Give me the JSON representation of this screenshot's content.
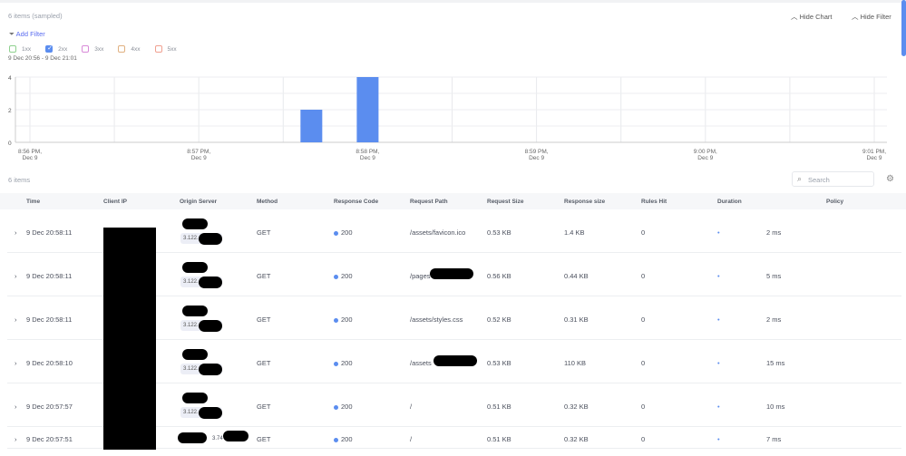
{
  "header": {
    "items_count": "6 items (sampled)",
    "hide_chart": "Hide Chart",
    "hide_filter": "Hide Filter",
    "add_filter": "Add Filter",
    "time_range": "9 Dec 20:56 - 9 Dec 21:01"
  },
  "legend": [
    {
      "label": "1xx",
      "color": "#8fd18f",
      "checked": false
    },
    {
      "label": "2xx",
      "color": "#5b8def",
      "checked": true
    },
    {
      "label": "3xx",
      "color": "#d88ad8",
      "checked": false
    },
    {
      "label": "4xx",
      "color": "#e0b080",
      "checked": false
    },
    {
      "label": "5xx",
      "color": "#f0a090",
      "checked": false
    }
  ],
  "chart_data": {
    "type": "bar",
    "title": "",
    "xlabel": "",
    "ylabel": "",
    "ylim": [
      0,
      4
    ],
    "yticks": [
      "0",
      "2",
      "4"
    ],
    "xlim_seconds": [
      0,
      300
    ],
    "xticks": [
      {
        "s": 0,
        "l1": "8:56 PM,",
        "l2": "Dec 9"
      },
      {
        "s": 60,
        "l1": "8:57 PM,",
        "l2": "Dec 9"
      },
      {
        "s": 120,
        "l1": "8:58 PM,",
        "l2": "Dec 9"
      },
      {
        "s": 180,
        "l1": "8:59 PM,",
        "l2": "Dec 9"
      },
      {
        "s": 240,
        "l1": "9:00 PM,",
        "l2": "Dec 9"
      },
      {
        "s": 300,
        "l1": "9:01 PM,",
        "l2": "Dec 9"
      }
    ],
    "series": [
      {
        "name": "2xx",
        "color": "#5b8def",
        "points": [
          {
            "s": 100,
            "value": 2
          },
          {
            "s": 120,
            "value": 4
          }
        ]
      }
    ]
  },
  "table": {
    "count": "6 items",
    "search_placeholder": "Search",
    "columns": [
      "Time",
      "Client IP",
      "Origin Server",
      "Method",
      "Response Code",
      "Request Path",
      "Request Size",
      "Response size",
      "Rules Hit",
      "Duration",
      "Policy"
    ],
    "rows": [
      {
        "time": "9 Dec 20:58:11",
        "ip_prefix": "3.122.",
        "method": "GET",
        "code": "200",
        "path": "/assets/favicon.ico",
        "req": "0.53 KB",
        "resp": "1.4 KB",
        "rules": "0",
        "duration": "2 ms"
      },
      {
        "time": "9 Dec 20:58:11",
        "ip_prefix": "3.122.",
        "method": "GET",
        "code": "200",
        "path": "/pages",
        "req": "0.56 KB",
        "resp": "0.44 KB",
        "rules": "0",
        "duration": "5 ms"
      },
      {
        "time": "9 Dec 20:58:11",
        "ip_prefix": "3.122.",
        "method": "GET",
        "code": "200",
        "path": "/assets/styles.css",
        "req": "0.52 KB",
        "resp": "0.31 KB",
        "rules": "0",
        "duration": "2 ms"
      },
      {
        "time": "9 Dec 20:58:10",
        "ip_prefix": "3.122.",
        "method": "GET",
        "code": "200",
        "path": "/assets",
        "req": "0.53 KB",
        "resp": "110 KB",
        "rules": "0",
        "duration": "15 ms"
      },
      {
        "time": "9 Dec 20:57:57",
        "ip_prefix": "3.122.",
        "method": "GET",
        "code": "200",
        "path": "/",
        "req": "0.51 KB",
        "resp": "0.32 KB",
        "rules": "0",
        "duration": "10 ms"
      },
      {
        "time": "9 Dec 20:57:51",
        "ip_prefix": "3.74",
        "method": "GET",
        "code": "200",
        "path": "/",
        "req": "0.51 KB",
        "resp": "0.32 KB",
        "rules": "0",
        "duration": "7 ms"
      }
    ]
  }
}
